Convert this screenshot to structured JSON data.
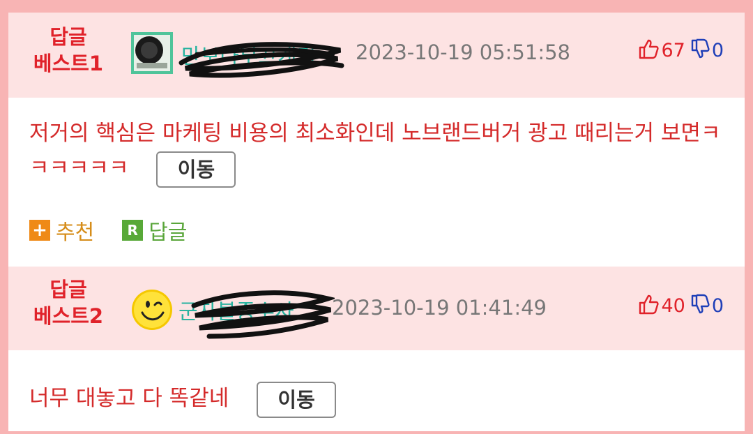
{
  "comments": [
    {
      "rank_line1": "답글",
      "rank_line2": "베스트1",
      "nickname": "만보다부끄개기",
      "datetime": "2023-10-19 05:51:58",
      "upvotes": "67",
      "downvotes": "0",
      "body": "저거의 핵심은 마케팅 비용의 최소화인데 노브랜드버거 광고 때리는거 보면ㅋㅋㅋㅋㅋㅋ",
      "move_label": "이동",
      "recommend_label": "추천",
      "reply_label": "답글",
      "recommend_icon": "+",
      "reply_icon": "R"
    },
    {
      "rank_line1": "답글",
      "rank_line2": "베스트2",
      "nickname": "군자불중수사",
      "datetime": "2023-10-19 01:41:49",
      "upvotes": "40",
      "downvotes": "0",
      "body": "너무 대놓고 다 똑같네",
      "move_label": "이동"
    }
  ],
  "colors": {
    "accent_red": "#e0222a",
    "nickname_teal": "#2ab3a0",
    "header_bg": "#fde3e3",
    "page_border": "#f8b4b4",
    "downvote_blue": "#1f3fb8"
  },
  "icons": [
    "thumbs-up-icon",
    "thumbs-down-icon",
    "smiley-avatar",
    "badge-avatar"
  ]
}
